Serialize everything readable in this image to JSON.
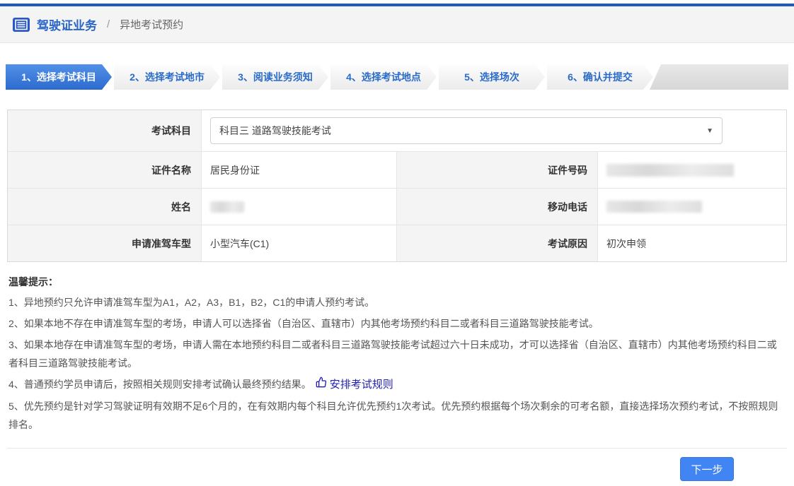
{
  "colors": {
    "top_bar": "#1f57c3",
    "accent_blue": "#2a65c8",
    "active_step_blue": "#2c6ace",
    "button_blue": "#4184f3",
    "link_navy": "#201eb4",
    "label_cell_bg": "#f4f4f4"
  },
  "breadcrumb": {
    "section": "驾驶证业务",
    "separator": "/",
    "current": "异地考试预约"
  },
  "steps": [
    {
      "label": "1、选择考试科目",
      "active": true
    },
    {
      "label": "2、选择考试地市",
      "active": false
    },
    {
      "label": "3、阅读业务须知",
      "active": false
    },
    {
      "label": "4、选择考试地点",
      "active": false
    },
    {
      "label": "5、选择场次",
      "active": false
    },
    {
      "label": "6、确认并提交",
      "active": false
    }
  ],
  "form": {
    "exam_subject_label": "考试科目",
    "exam_subject_value": "科目三 道路驾驶技能考试",
    "id_type_label": "证件名称",
    "id_type_value": "居民身份证",
    "id_number_label": "证件号码",
    "id_number_redacted": true,
    "name_label": "姓名",
    "name_redacted": true,
    "mobile_label": "移动电话",
    "mobile_redacted": true,
    "vehicle_type_label": "申请准驾车型",
    "vehicle_type_value": "小型汽车(C1)",
    "exam_reason_label": "考试原因",
    "exam_reason_value": "初次申领"
  },
  "tips": {
    "title": "温馨提示：",
    "item1": "1、异地预约只允许申请准驾车型为A1，A2，A3，B1，B2，C1的申请人预约考试。",
    "item2": "2、如果本地不存在申请准驾车型的考场，申请人可以选择省（自治区、直辖市）内其他考场预约科目二或者科目三道路驾驶技能考试。",
    "item3": "3、如果本地存在申请准驾车型的考场，申请人需在本地预约科目二或者科目三道路驾驶技能考试超过六十日未成功，才可以选择省（自治区、直辖市）内其他考场预约科目二或者科目三道路驾驶技能考试。",
    "item4_prefix": "4、普通预约学员申请后，按照相关规则安排考试确认最终预约结果。",
    "item4_link_label": "安排考试规则",
    "item5": "5、优先预约是针对学习驾驶证明有效期不足6个月的，在有效期内每个科目允许优先预约1次考试。优先预约根据每个场次剩余的可考名额，直接选择场次预约考试，不按照规则排名。"
  },
  "footer": {
    "next_label": "下一步"
  }
}
